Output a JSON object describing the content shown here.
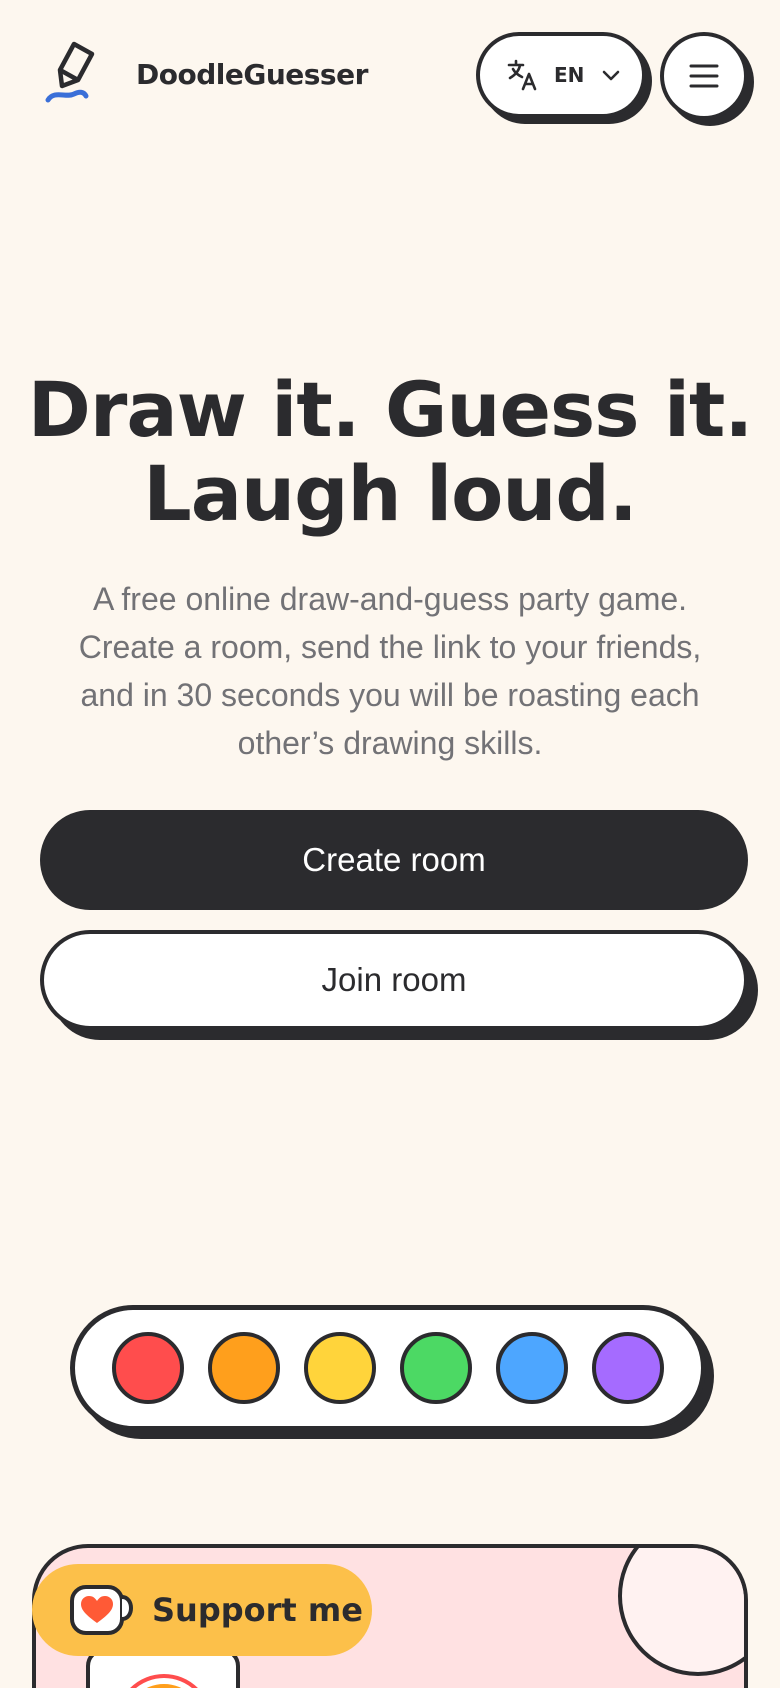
{
  "header": {
    "brand": "DoodleGuesser",
    "language": {
      "code": "EN"
    }
  },
  "hero": {
    "title_line1": "Draw it. Guess it.",
    "title_line2": "Laugh loud.",
    "subtitle": "A free online draw-and-guess party game. Create a room, send the link to your friends, and in 30 seconds you will be roasting each other’s drawing skills."
  },
  "actions": {
    "create_label": "Create room",
    "join_label": "Join room"
  },
  "palette": {
    "colors": [
      {
        "name": "red",
        "hex": "#ff4d4d"
      },
      {
        "name": "orange",
        "hex": "#ff9f1c"
      },
      {
        "name": "yellow",
        "hex": "#ffd43b"
      },
      {
        "name": "green",
        "hex": "#4cd964"
      },
      {
        "name": "blue",
        "hex": "#4da6ff"
      },
      {
        "name": "purple",
        "hex": "#a56bff"
      }
    ]
  },
  "support": {
    "label": "Support me"
  },
  "theme": {
    "background": "#fdf7ef",
    "ink": "#2b2b2e",
    "accent_yellow": "#fcc04a",
    "card_pink": "#ffe1e2",
    "logo_blue": "#3a6fd8"
  },
  "icons": {
    "logo": "pen-scribble-icon",
    "language": "translate-icon",
    "dropdown": "chevron-down-icon",
    "menu": "hamburger-menu-icon",
    "support": "coffee-heart-icon"
  }
}
